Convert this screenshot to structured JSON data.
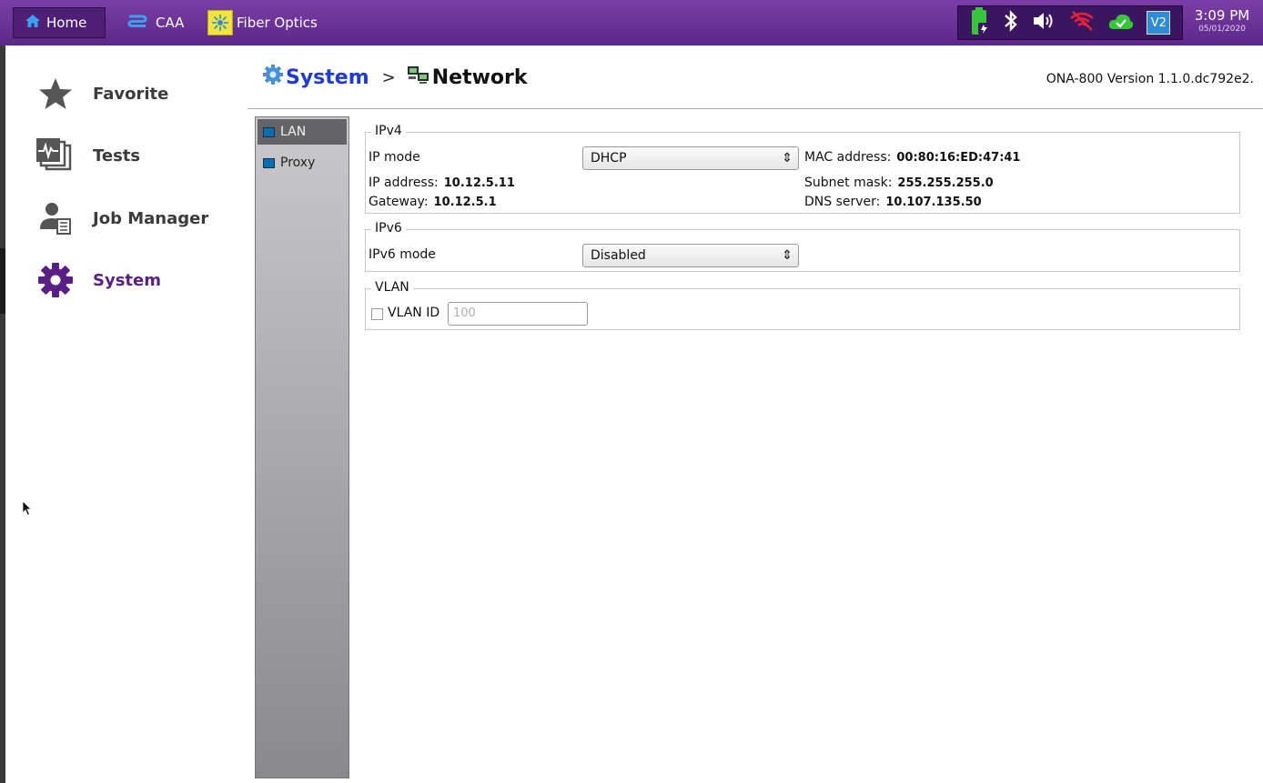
{
  "topbar": {
    "tabs": [
      {
        "label": "Home",
        "icon": "home-icon"
      },
      {
        "label": "CAA",
        "icon": "caa-icon"
      },
      {
        "label": "Fiber Optics",
        "icon": "fiber-optics-icon"
      }
    ],
    "status_icons": [
      "battery-charging-icon",
      "bluetooth-icon",
      "speaker-icon",
      "wifi-disabled-icon",
      "cloud-check-icon",
      "vnc-icon"
    ],
    "vnc_label": "V2",
    "time": "3:09 PM",
    "date": "05/01/2020",
    "colors": {
      "bar": "#5c2789",
      "accent": "#1f3bd6"
    }
  },
  "nav": {
    "items": [
      {
        "label": "Favorite",
        "icon": "star-icon"
      },
      {
        "label": "Tests",
        "icon": "tests-icon"
      },
      {
        "label": "Job Manager",
        "icon": "job-manager-icon"
      },
      {
        "label": "System",
        "icon": "gear-icon",
        "active": true
      }
    ]
  },
  "header": {
    "breadcrumb_system": "System",
    "breadcrumb_sep": ">",
    "breadcrumb_network": "Network",
    "version": "ONA-800 Version 1.1.0.dc792e2."
  },
  "subtabs": [
    {
      "label": "LAN",
      "active": true
    },
    {
      "label": "Proxy",
      "active": false
    }
  ],
  "ipv4": {
    "title": "IPv4",
    "mode_label": "IP mode",
    "mode_value": "DHCP",
    "mac_label": "MAC address:",
    "mac_value": "00:80:16:ED:47:41",
    "ip_label": "IP address:",
    "ip_value": "10.12.5.11",
    "subnet_label": "Subnet mask:",
    "subnet_value": "255.255.255.0",
    "gateway_label": "Gateway:",
    "gateway_value": "10.12.5.1",
    "dns_label": "DNS server:",
    "dns_value": "10.107.135.50"
  },
  "ipv6": {
    "title": "IPv6",
    "mode_label": "IPv6 mode",
    "mode_value": "Disabled"
  },
  "vlan": {
    "title": "VLAN",
    "id_label": "VLAN ID",
    "id_placeholder": "100",
    "checked": false
  }
}
